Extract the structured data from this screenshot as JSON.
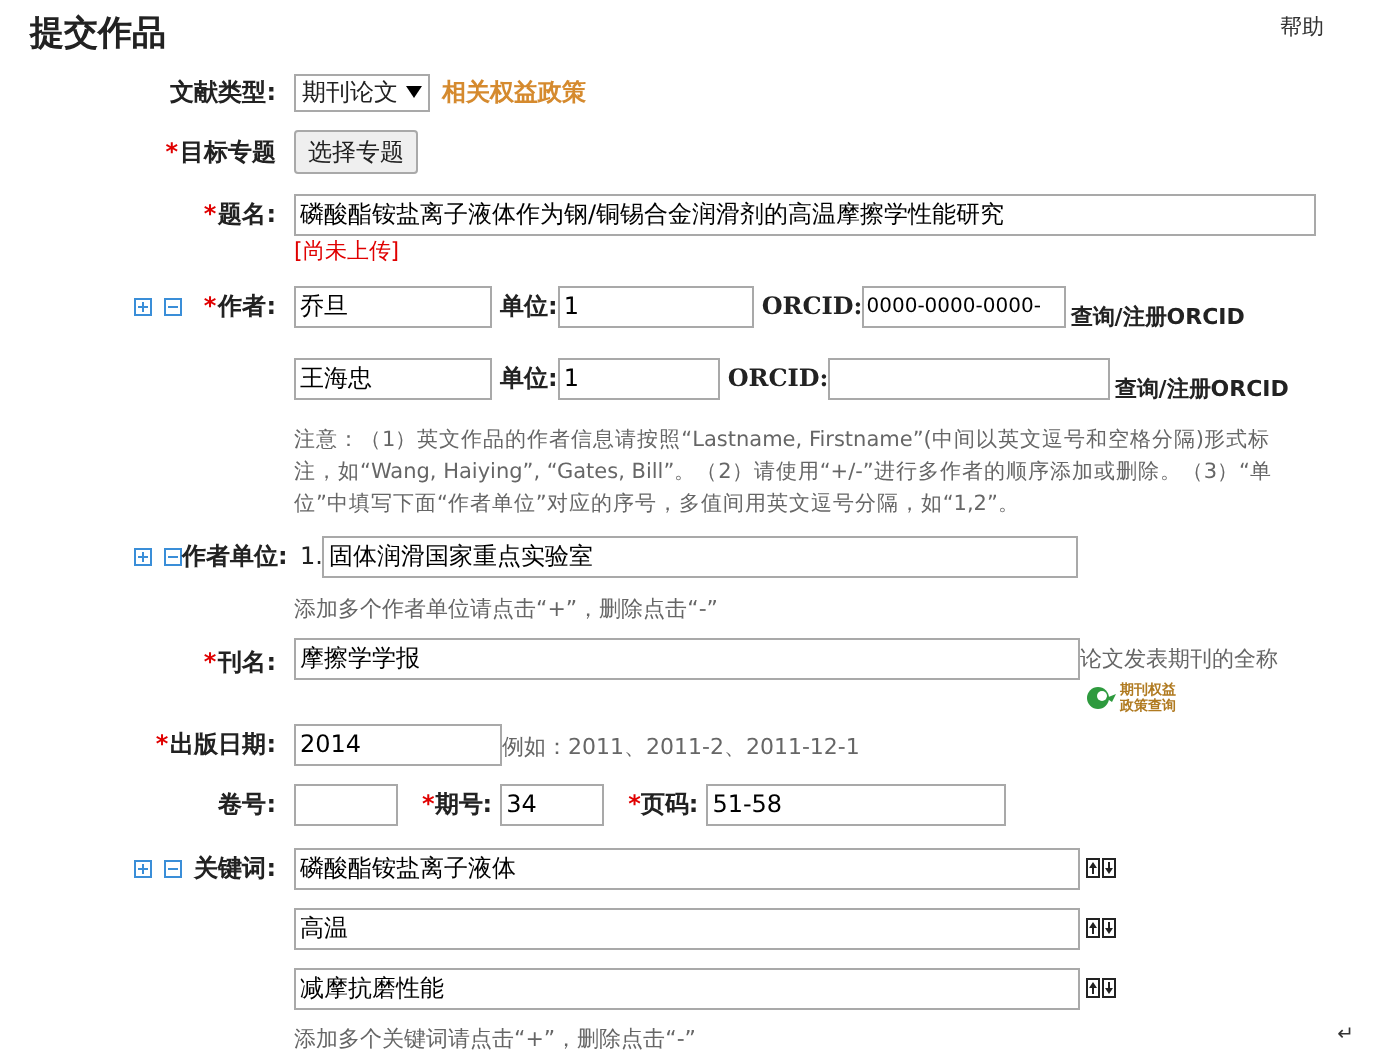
{
  "page_title": "提交作品",
  "help_link": "帮助",
  "doc_type": {
    "label": "文献类型:",
    "value": "期刊论文",
    "policy_link": "相关权益政策"
  },
  "topic": {
    "required_mark": "*",
    "label": "目标专题",
    "button": "选择专题"
  },
  "title": {
    "required_mark": "*",
    "label": "题名:",
    "value": "磷酸酯铵盐离子液体作为钢/铜锡合金润滑剂的高温摩擦学性能研究",
    "status": "[尚未上传]"
  },
  "authors": {
    "required_mark": "*",
    "label": "作者:",
    "rows": [
      {
        "name": "乔旦",
        "unit_label": "单位:",
        "unit": "1",
        "orcid_label": "ORCID:",
        "orcid": "0000-0000-0000-",
        "orcid_link": "查询/注册ORCID"
      },
      {
        "name": "王海忠",
        "unit_label": "单位:",
        "unit": "1",
        "orcid_label": "ORCID:",
        "orcid_link": "查询/注册ORCID"
      }
    ],
    "note": "注意：（1）英文作品的作者信息请按照“Lastname, Firstname”(中间以英文逗号和空格分隔)形式标注，如“Wang, Haiying”, “Gates, Bill”。（2）请使用“+/-”进行多作者的顺序添加或删除。（3）“单位”中填写下面“作者单位”对应的序号，多值间用英文逗号分隔，如“1,2”。"
  },
  "affiliations": {
    "label": "作者单位:",
    "items": [
      {
        "number": "1.",
        "value": "固体润滑国家重点实验室"
      }
    ],
    "hint": "添加多个作者单位请点击“+”，删除点击“-”"
  },
  "journal": {
    "required_mark": "*",
    "label": "刊名:",
    "value": "摩擦学学报",
    "hint": "论文发表期刊的全称",
    "badge": [
      "期刊权益",
      "政策查询"
    ]
  },
  "pub_date": {
    "required_mark": "*",
    "label": "出版日期:",
    "value": "2014",
    "example": "例如：2011、2011-2、2011-12-1"
  },
  "volume": {
    "label": "卷号:"
  },
  "issue": {
    "required_mark": "*",
    "label": "期号:",
    "value": "34"
  },
  "pages": {
    "required_mark": "*",
    "label": "页码:",
    "value": "51-58"
  },
  "keywords": {
    "label": "关键词:",
    "items": [
      "磷酸酯铵盐离子液体",
      "高温",
      "减摩抗磨性能"
    ],
    "hint": "添加多个关键词请点击“+”，删除点击“-”"
  },
  "corner_mark": "↵"
}
